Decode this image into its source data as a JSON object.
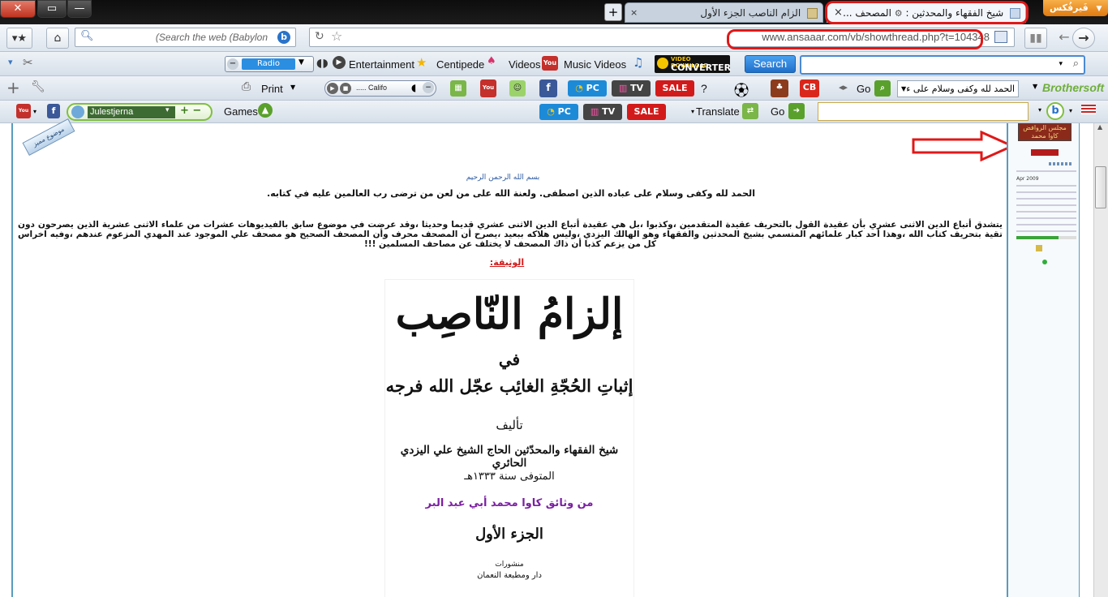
{
  "window": {
    "firefox_label": "فَيرفُكس",
    "close_glyph": "✕",
    "maximize_glyph": "▭",
    "minimize_glyph": "—"
  },
  "tabs": {
    "active_title": "شيخ الفقهاء والمحدثين :",
    "active_suffix": "المصحف ...",
    "second_title": "الزام الناصب الجزء الأول",
    "new_tab": "+",
    "close": "×"
  },
  "navbar": {
    "search_placeholder": "(Search the web (Babylon",
    "url": "www.ansaaar.com/vb/showthread.php?t=104348"
  },
  "toolbar1": {
    "radio": "Radio",
    "entertainment": "Entertainment",
    "centipede": "Centipede",
    "videos": "Videos",
    "music_videos": "Music Videos",
    "converter_top": "VIDEO DOWNLOAD",
    "converter_bottom": "CONVERTER",
    "search_button": "Search"
  },
  "toolbar2": {
    "print": "Print",
    "player_text": "..... Califo",
    "pc": "PC",
    "tv": "TV",
    "sale": "SALE",
    "question": "?",
    "cb": "CB",
    "go": "Go",
    "select_value": "الحمد لله وكفى وسلام على ء",
    "brothersoft": "Brothersoft"
  },
  "toolbar3": {
    "user": "Julestjerna",
    "games": "Games",
    "pc": "PC",
    "tv": "TV",
    "sale": "SALE",
    "translate": "Translate",
    "go": "Go"
  },
  "post": {
    "badge": "موضوع مميز",
    "basmala": "بسم الله الرحمن الرحيم",
    "line1": "الحمد لله وكفى وسلام على عباده الذين اصطفى. ولعنة الله على من لعن من ترضى رب العالمين عليه في كتابه.",
    "para": "يتشدق أتباع الدين الاثنى عشري بأن عقيدة القول بالتحريف عقيدة المتقدمين ،وكذبوا ،بل هي عقيدة أتباع الدين الاثنى عشري قديما وحديثا ،وقد عرضت في موضوع سابق بالفيديوهات عشرات من علماء الاثنى عشرية الذين يصرحون دون تقية بتحريف كتاب الله ،وهذا أحد كبار علمائهم المتسمي بشيخ المحدثين والفقهاء وهو الهالك اليزدي ،وليس هلاكه ببعيد ،يصرح أن المصحف محرف وأن المصحف الصحيح هو مصحف علي الموجود عند المهدي المزعوم عندهم ،وفيه اخراس كل من يزعم كذبا أن ذاك المصحف لا يختلف عن مصاحف المسلمين !!!",
    "watheeqa": "الوثيقة:"
  },
  "book": {
    "title": "إلزامُ النّاصِب",
    "fi": "في",
    "subtitle": "إثباتِ الحُجّةِ الغائِب عجّل الله فرجه",
    "taleef": "تأليف",
    "author": "شيخ الفقهاء والمحدّثين الحاج الشيخ علي اليزدي الحائري",
    "died": "المتوفى سنة ١٣٣٣هـ",
    "source": "من وثائق كاوا محمد أبي عبد البر",
    "part": "الجزء الأول",
    "publisher1": "منشورات",
    "publisher2": "دار ومطبعة النعمان"
  },
  "sidebar": {
    "avatar_caption": "مجلس الروافض كاوا محمد",
    "date": "Apr 2009"
  },
  "colors": {
    "accent_blue": "#5a9abf",
    "annotation_red": "#e01818",
    "source_purple": "#7b1fa2"
  }
}
